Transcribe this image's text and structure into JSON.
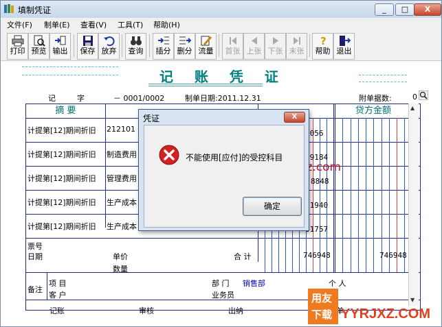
{
  "window": {
    "title": "填制凭证",
    "min": "_",
    "max": "□",
    "close": "X"
  },
  "menu": [
    "文件(F)",
    "制单(E)",
    "查看(V)",
    "工具(T)",
    "帮助(H)"
  ],
  "toolbar": [
    {
      "label": "打印",
      "icon": "printer-icon",
      "enabled": true
    },
    {
      "label": "预览",
      "icon": "preview-icon",
      "enabled": true
    },
    {
      "label": "输出",
      "icon": "export-icon",
      "enabled": true
    },
    {
      "label": "保存",
      "icon": "save-icon",
      "enabled": true
    },
    {
      "label": "放弃",
      "icon": "undo-icon",
      "enabled": true
    },
    {
      "label": "查询",
      "icon": "binoculars-icon",
      "enabled": true
    },
    {
      "label": "插分",
      "icon": "insert-row-icon",
      "enabled": true
    },
    {
      "label": "删分",
      "icon": "delete-row-icon",
      "enabled": true
    },
    {
      "label": "流量",
      "icon": "flow-icon",
      "enabled": true
    },
    {
      "label": "首张",
      "icon": "first-icon",
      "enabled": false
    },
    {
      "label": "上张",
      "icon": "prev-icon",
      "enabled": false
    },
    {
      "label": "下张",
      "icon": "next-icon",
      "enabled": false
    },
    {
      "label": "末张",
      "icon": "last-icon",
      "enabled": false
    },
    {
      "label": "帮助",
      "icon": "help-icon",
      "enabled": true
    },
    {
      "label": "退出",
      "icon": "exit-icon",
      "enabled": true
    }
  ],
  "voucher": {
    "title": "记 账 凭 证",
    "type_label": "记",
    "zi": "字",
    "number": "－ 0001/0002",
    "date_label": "制单日期:2011.12.31",
    "attach_label": "附单据数:",
    "attach_value": "0",
    "col_summary": "摘 要",
    "col_debit_partial": "借方金额",
    "col_credit": "贷方金额",
    "rows": [
      {
        "summary": "计提第[12]期间折旧",
        "account": "212101",
        "debit": "5056"
      },
      {
        "summary": "计提第[12]期间折旧",
        "account": "制造费用",
        "debit": "39184"
      },
      {
        "summary": "计提第[12]期间折旧",
        "account": "管理费用",
        "debit": "8848"
      },
      {
        "summary": "计提第[12]期间折旧",
        "account": "生产成本",
        "debit": "61940"
      },
      {
        "summary": "计提第[12]期间折旧",
        "account": "生产成本",
        "debit": "61757"
      }
    ],
    "ticket_no": "票号",
    "date": "日期",
    "unit_price": "单价",
    "quantity": "数量",
    "total_label": "合 计",
    "total_debit": "746948",
    "total_credit": "746948",
    "remark": "备注",
    "project": "项 目",
    "customer": "客 户",
    "dept": "部 门",
    "dept_value": "销售部",
    "person": "个 人",
    "salesman": "业务员",
    "bookkeeping": "记账",
    "audit": "审核",
    "cashier": "出纳",
    "maker": "制单"
  },
  "dialog": {
    "title": "凭证",
    "message": "不能使用[应付]的受控科目",
    "ok": "确定",
    "close": "X"
  },
  "watermark": "www.yyrjxz.com",
  "logo": {
    "badge_top": "用友",
    "badge_bottom": "下载",
    "text": "YYRJXZ.COM"
  }
}
